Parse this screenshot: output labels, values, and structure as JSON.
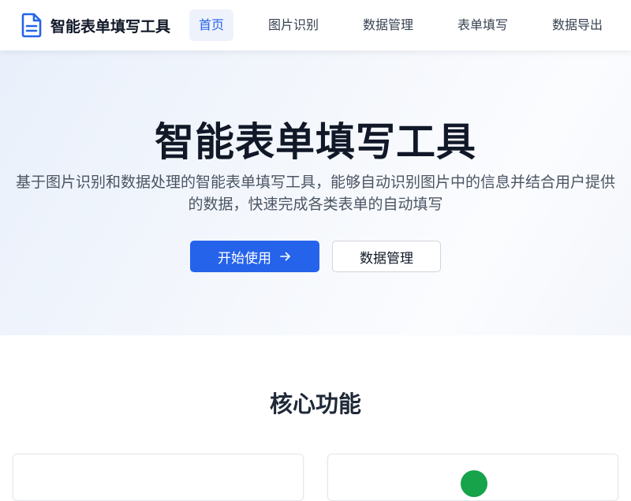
{
  "header": {
    "logo_text": "智能表单填写工具",
    "nav": [
      {
        "label": "首页",
        "active": true
      },
      {
        "label": "图片识别",
        "active": false
      },
      {
        "label": "数据管理",
        "active": false
      },
      {
        "label": "表单填写",
        "active": false
      },
      {
        "label": "数据导出",
        "active": false
      }
    ]
  },
  "hero": {
    "title": "智能表单填写工具",
    "description": "基于图片识别和数据处理的智能表单填写工具，能够自动识别图片中的信息并结合用户提供的数据，快速完成各类表单的自动填写",
    "primary_button": "开始使用",
    "secondary_button": "数据管理"
  },
  "features": {
    "title": "核心功能"
  },
  "colors": {
    "accent": "#2563eb",
    "nav_active_bg": "#eef2fb",
    "feature_icon": "#16a34a"
  },
  "icons": {
    "logo": "document-icon",
    "primary_button": "arrow-right-icon"
  }
}
